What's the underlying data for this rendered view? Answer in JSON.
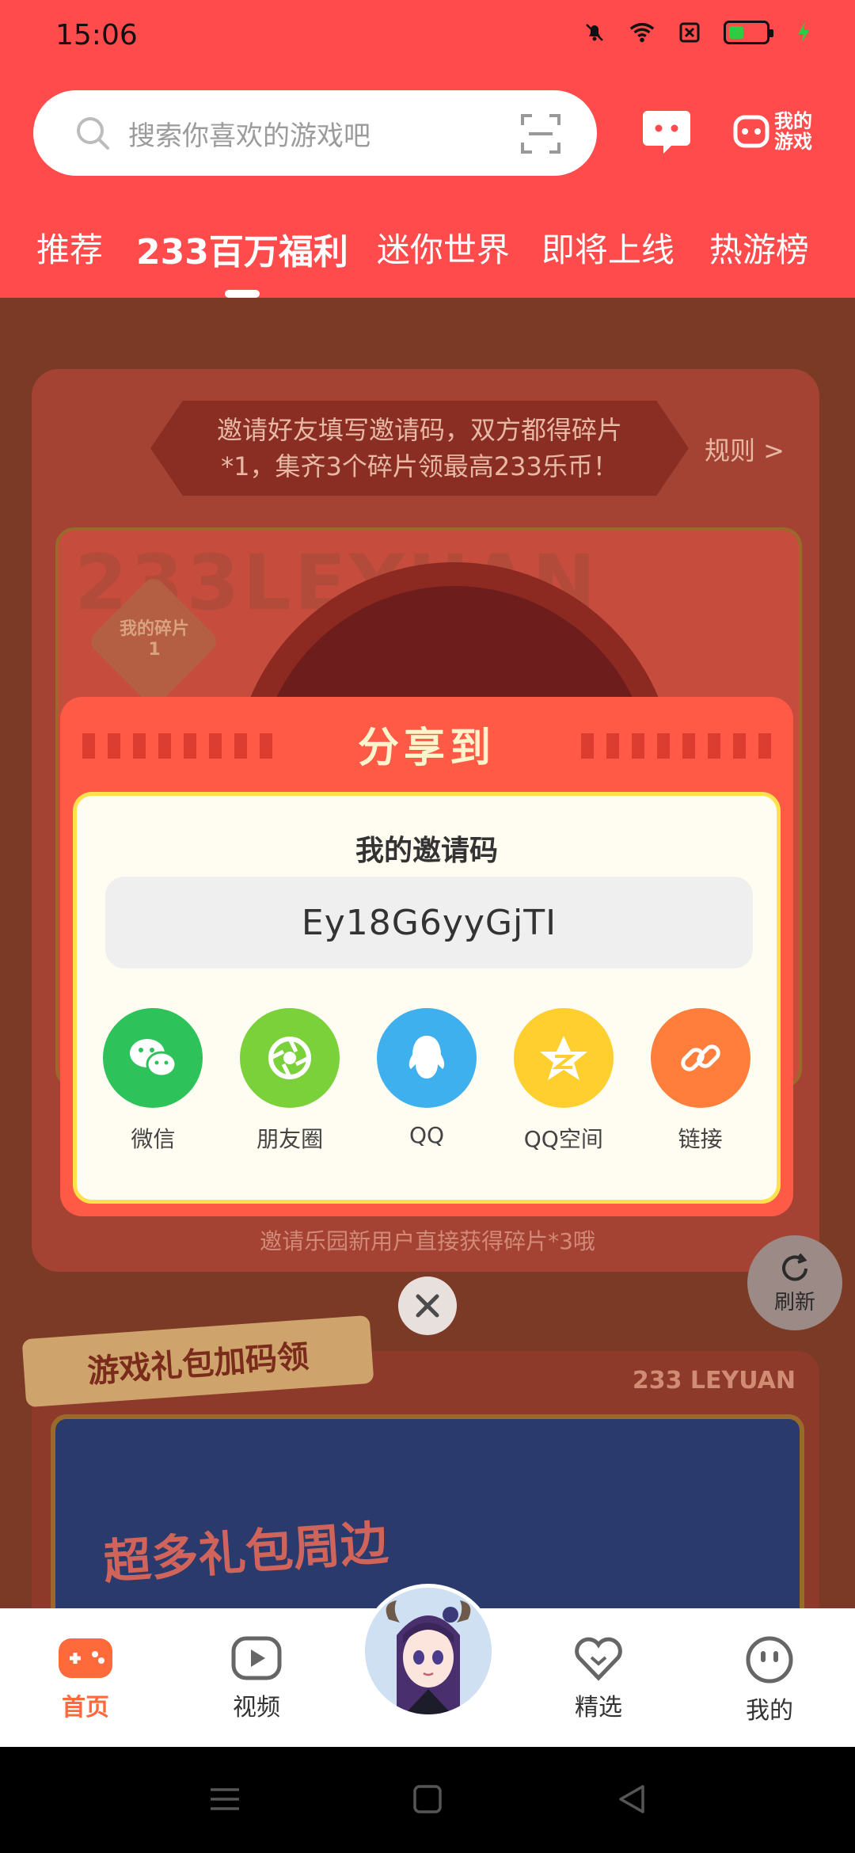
{
  "status_bar": {
    "time": "15:06"
  },
  "header": {
    "search_placeholder": "搜索你喜欢的游戏吧",
    "my_games_label": "我的\n游戏",
    "tabs": [
      {
        "label": "推荐"
      },
      {
        "label": "233百万福利"
      },
      {
        "label": "迷你世界"
      },
      {
        "label": "即将上线"
      },
      {
        "label": "热游榜"
      }
    ],
    "active_tab_index": 1
  },
  "background_content": {
    "invite_banner_line1": "邀请好友填写邀请码，双方都得碎片",
    "invite_banner_line2": "*1，集齐3个碎片领最高233乐币！",
    "rules_link": "规则 >",
    "poster_text": "233LEYUAN",
    "shard_label": "我的碎片",
    "shard_count": "1",
    "bottom_note": "邀请乐园新用户直接获得碎片*3哦",
    "refresh_label": "刷新",
    "gift_section_title": "游戏礼包加码领",
    "leyuan_label": "233 LEYUAN",
    "gift_poster_text": "超多礼包周边"
  },
  "share_modal": {
    "title": "分享到",
    "invite_code_label": "我的邀请码",
    "invite_code": "Ey18G6yyGjTI",
    "options": [
      {
        "label": "微信",
        "icon": "wechat-icon",
        "color": "#2dc35a"
      },
      {
        "label": "朋友圈",
        "icon": "moments-icon",
        "color": "#7ad13a"
      },
      {
        "label": "QQ",
        "icon": "qq-icon",
        "color": "#3fb0ee"
      },
      {
        "label": "QQ空间",
        "icon": "qzone-icon",
        "color": "#ffcf30"
      },
      {
        "label": "链接",
        "icon": "link-icon",
        "color": "#ff7e3b"
      }
    ]
  },
  "bottom_nav": {
    "items": [
      {
        "label": "首页",
        "icon": "home-gamepad-icon",
        "active": true
      },
      {
        "label": "视频",
        "icon": "video-play-icon",
        "active": false
      },
      {
        "label": "精选",
        "icon": "heart-badge-icon",
        "active": false
      },
      {
        "label": "我的",
        "icon": "profile-face-icon",
        "active": false
      }
    ]
  },
  "colors": {
    "header_red": "#ff4b4b",
    "accent_orange": "#ff6a3a",
    "modal_red": "#ff5a46",
    "modal_border_yellow": "#ffe14d"
  }
}
